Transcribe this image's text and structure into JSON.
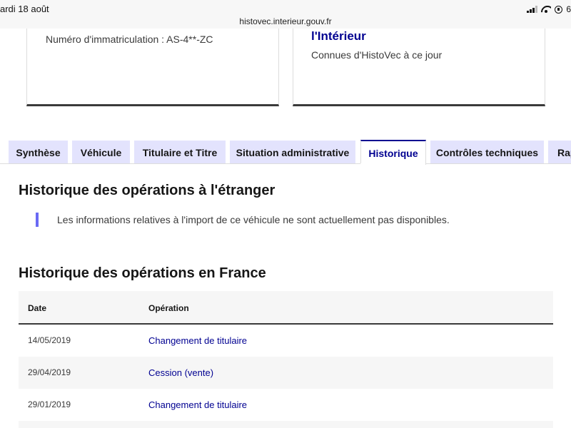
{
  "status_bar": {
    "date": "ardi 18 août",
    "url": "histovec.interieur.gouv.fr",
    "battery": "6"
  },
  "cards": {
    "left": {
      "plate": "Numéro d'immatriculation : AS-4**-ZC"
    },
    "right": {
      "heading": "l'Intérieur",
      "subtitle": "Connues d'HistoVec à ce jour"
    }
  },
  "tabs": [
    {
      "label": "Synthèse"
    },
    {
      "label": "Véhicule"
    },
    {
      "label": "Titulaire et Titre"
    },
    {
      "label": "Situation administrative"
    },
    {
      "label": "Historique",
      "active": true
    },
    {
      "label": "Contrôles techniques"
    },
    {
      "label": "Rap"
    }
  ],
  "etranger": {
    "title": "Historique des opérations à l'étranger",
    "notice": "Les informations relatives à l'import de ce véhicule ne sont actuellement pas disponibles."
  },
  "france": {
    "title": "Historique des opérations en France",
    "columns": {
      "date": "Date",
      "operation": "Opération"
    },
    "rows": [
      {
        "date": "14/05/2019",
        "operation": "Changement de titulaire"
      },
      {
        "date": "29/04/2019",
        "operation": "Cession (vente)"
      },
      {
        "date": "29/01/2019",
        "operation": "Changement de titulaire"
      }
    ]
  },
  "colors": {
    "accent": "#000091",
    "tab_bg": "#e3e3fd",
    "quote_bar": "#6a6af4"
  }
}
